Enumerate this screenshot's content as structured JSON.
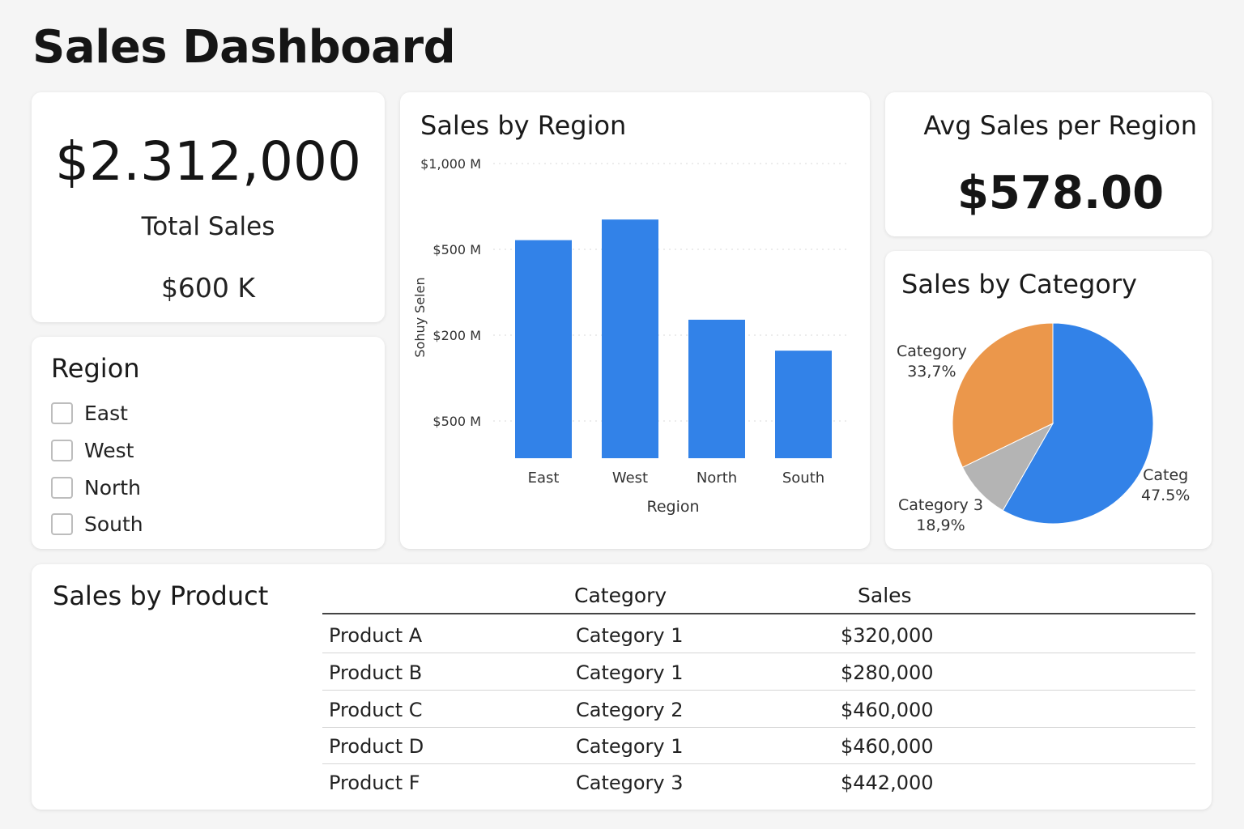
{
  "page_title": "Sales Dashboard",
  "kpi": {
    "total_value": "$2.312,000",
    "total_label": "Total Sales",
    "secondary_value": "$600 K"
  },
  "region_filter": {
    "title": "Region",
    "options": [
      {
        "label": "East",
        "checked": false
      },
      {
        "label": "West",
        "checked": false
      },
      {
        "label": "North",
        "checked": false
      },
      {
        "label": "South",
        "checked": false
      }
    ]
  },
  "avg_card": {
    "title": "Avg Sales per Region",
    "value": "$578.00"
  },
  "colors": {
    "bar": "#3282e8",
    "pie_blue": "#3282e8",
    "pie_orange": "#eb974b",
    "pie_gray": "#b4b4b4"
  },
  "chart_data": [
    {
      "type": "bar",
      "title": "Sales by Region",
      "xlabel": "Region",
      "ylabel": "Sohuy Selen",
      "y_tick_labels": [
        "$1,000 M",
        "$500 M",
        "$200 M",
        "$500 M"
      ],
      "categories": [
        "East",
        "West",
        "North",
        "South"
      ],
      "values": [
        740,
        810,
        470,
        365
      ],
      "ylim": [
        0,
        1000
      ],
      "grid": true
    },
    {
      "type": "pie",
      "title": "Sales by Category",
      "slices": [
        {
          "label": "Categ",
          "percent_label": "47.5%",
          "value": 58.3,
          "color": "#3282e8"
        },
        {
          "label": "Category 3",
          "percent_label": "18,9%",
          "value": 9.5,
          "color": "#b4b4b4"
        },
        {
          "label": "Category",
          "percent_label": "33,7%",
          "value": 32.2,
          "color": "#eb974b"
        }
      ]
    }
  ],
  "product_table": {
    "title": "Sales by Product",
    "columns": [
      "",
      "Category",
      "Sales"
    ],
    "rows": [
      {
        "product": "Product A",
        "category": "Category 1",
        "sales": "$320,000"
      },
      {
        "product": "Product B",
        "category": "Category 1",
        "sales": "$280,000"
      },
      {
        "product": "Product C",
        "category": "Category 2",
        "sales": "$460,000"
      },
      {
        "product": "Product D",
        "category": "Category 1",
        "sales": "$460,000"
      },
      {
        "product": "Product F",
        "category": "Category 3",
        "sales": "$442,000"
      }
    ]
  }
}
